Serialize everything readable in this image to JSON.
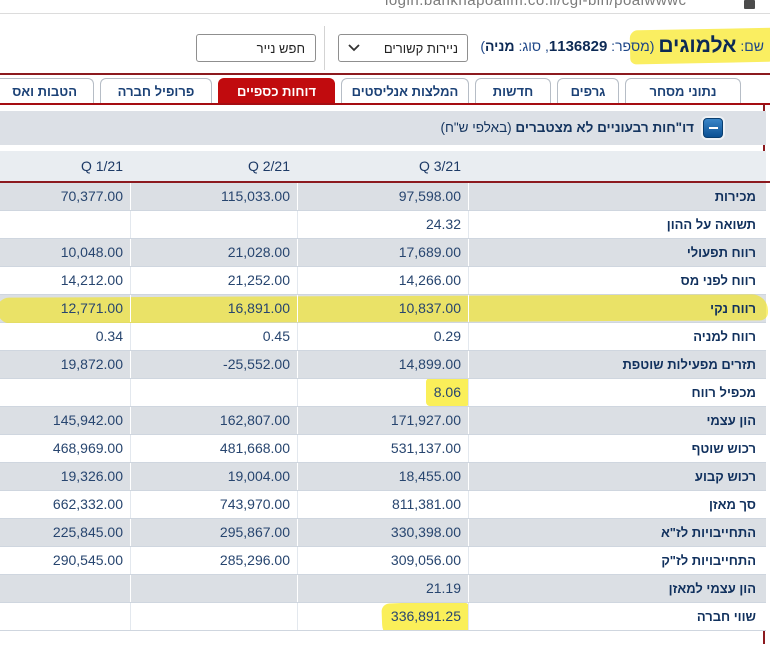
{
  "browser": {
    "url_fragment": "login.bankhapoalim.co.il/cgi-bin/poalwwwc"
  },
  "header": {
    "name_label": "שם: ",
    "name_value": "אלמוגים",
    "number_prefix": " (מספר: ",
    "number_value": "1136829",
    "type_prefix": ", סוג: ",
    "type_value": "מניה",
    "type_suffix": ")",
    "related_select_value": "ניירות קשורים",
    "search_button_label": "חפש נייר"
  },
  "tabs": [
    {
      "label": "נתוני מסחר",
      "active": false
    },
    {
      "label": "גרפים",
      "active": false
    },
    {
      "label": "חדשות",
      "active": false
    },
    {
      "label": "המלצות אנליסטים",
      "active": false
    },
    {
      "label": "דוחות כספיים",
      "active": true
    },
    {
      "label": "פרופיל חברה",
      "active": false
    },
    {
      "label": "הטבות ואס",
      "active": false
    }
  ],
  "section": {
    "title_bold": "דו\"חות רבעוניים לא מצטברים",
    "title_rest": " (באלפי ש\"ח)",
    "collapse_icon": "minus"
  },
  "table": {
    "columns": [
      "Q 3/21",
      "Q 2/21",
      "Q 1/21"
    ],
    "rows": [
      {
        "label": "מכירות",
        "q3": "97,598.00",
        "q2": "115,033.00",
        "q1": "70,377.00",
        "highlight": null
      },
      {
        "label": "תשואה על ההון",
        "q3": "24.32",
        "q2": "",
        "q1": "",
        "highlight": null
      },
      {
        "label": "רווח תפעולי",
        "q3": "17,689.00",
        "q2": "21,028.00",
        "q1": "10,048.00",
        "highlight": null
      },
      {
        "label": "רווח לפני מס",
        "q3": "14,266.00",
        "q2": "21,252.00",
        "q1": "14,212.00",
        "highlight": null
      },
      {
        "label": "רווח נקי",
        "q3": "10,837.00",
        "q2": "16,891.00",
        "q1": "12,771.00",
        "highlight": "row"
      },
      {
        "label": "רווח למניה",
        "q3": "0.29",
        "q2": "0.45",
        "q1": "0.34",
        "highlight": null
      },
      {
        "label": "תזרים מפעילות שוטפת",
        "q3": "14,899.00",
        "q2": "-25,552.00",
        "q1": "19,872.00",
        "highlight": null
      },
      {
        "label": "מכפיל רווח",
        "q3": "8.06",
        "q2": "",
        "q1": "",
        "highlight": "q3"
      },
      {
        "label": "הון עצמי",
        "q3": "171,927.00",
        "q2": "162,807.00",
        "q1": "145,942.00",
        "highlight": null
      },
      {
        "label": "רכוש שוטף",
        "q3": "531,137.00",
        "q2": "481,668.00",
        "q1": "468,969.00",
        "highlight": null
      },
      {
        "label": "רכוש קבוע",
        "q3": "18,455.00",
        "q2": "19,004.00",
        "q1": "19,326.00",
        "highlight": null
      },
      {
        "label": "סך מאזן",
        "q3": "811,381.00",
        "q2": "743,970.00",
        "q1": "662,332.00",
        "highlight": null
      },
      {
        "label": "התחייבויות לז\"א",
        "q3": "330,398.00",
        "q2": "295,867.00",
        "q1": "225,845.00",
        "highlight": null
      },
      {
        "label": "התחייבויות לז\"ק",
        "q3": "309,056.00",
        "q2": "285,296.00",
        "q1": "290,545.00",
        "highlight": null
      },
      {
        "label": "הון עצמי למאזן",
        "q3": "21.19",
        "q2": "",
        "q1": "",
        "highlight": null
      },
      {
        "label": "שווי חברה",
        "q3": "336,891.25",
        "q2": "",
        "q1": "",
        "highlight": "q3"
      }
    ]
  },
  "colors": {
    "active_tab_red": "#c10b0e",
    "maroon_border": "#8c1a1f",
    "highlight_yellow": "#f6e400",
    "navy_text": "#16365f",
    "gray_row": "#dbdfe4"
  }
}
